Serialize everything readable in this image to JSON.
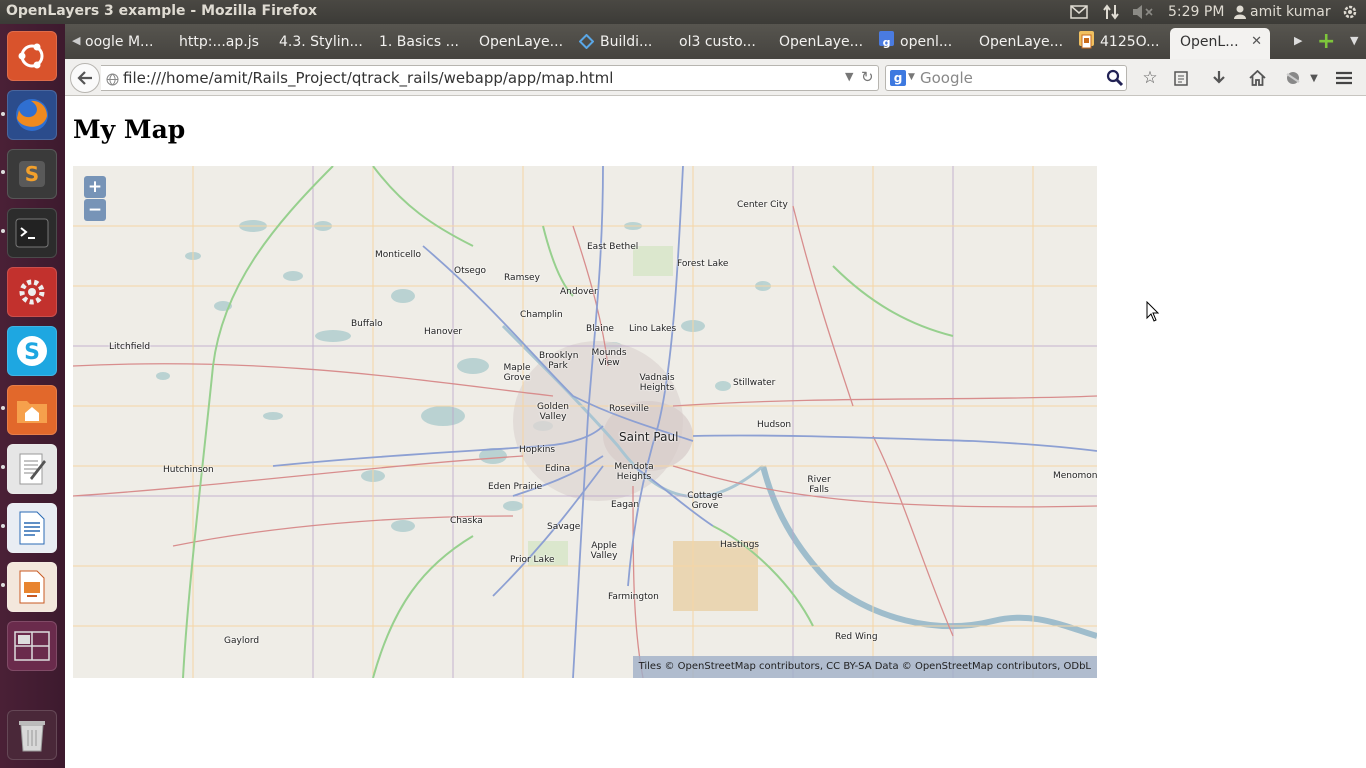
{
  "window": {
    "title": "OpenLayers 3 example - Mozilla Firefox"
  },
  "top_panel": {
    "time": "5:29 PM",
    "user": "amit kumar"
  },
  "launcher": {
    "items": [
      "ubuntu-dash-icon",
      "firefox-icon",
      "sublime-text-icon",
      "terminal-icon",
      "system-settings-icon",
      "skype-icon",
      "files-icon",
      "text-editor-icon",
      "libreoffice-writer-icon",
      "libreoffice-impress-icon",
      "workspace-switcher-icon",
      "trash-icon"
    ]
  },
  "tabs": [
    {
      "label": "oogle M...",
      "favicon": "none"
    },
    {
      "label": "http:...ap.js",
      "favicon": "none"
    },
    {
      "label": "4.3. Stylin...",
      "favicon": "none"
    },
    {
      "label": "1. Basics ...",
      "favicon": "none"
    },
    {
      "label": "OpenLaye...",
      "favicon": "none"
    },
    {
      "label": "Buildi...",
      "favicon": "diamond-icon"
    },
    {
      "label": "ol3 custo...",
      "favicon": "none"
    },
    {
      "label": "OpenLaye...",
      "favicon": "none"
    },
    {
      "label": "openl...",
      "favicon": "google-icon"
    },
    {
      "label": "OpenLaye...",
      "favicon": "none"
    },
    {
      "label": "4125O...",
      "favicon": "doc-icon"
    },
    {
      "label": "OpenL...",
      "favicon": "none",
      "active": true
    }
  ],
  "navbar": {
    "url": "file:///home/amit/Rails_Project/qtrack_rails/webapp/app/map.html",
    "search_placeholder": "Google"
  },
  "page": {
    "title": "My Map",
    "zoom_in": "+",
    "zoom_out": "−",
    "attribution": "Tiles © OpenStreetMap contributors, CC BY-SA    Data © OpenStreetMap contributors, ODbL"
  },
  "map_labels": {
    "center_city": "Center City",
    "east_bethel": "East Bethel",
    "forest_lake": "Forest Lake",
    "monticello": "Monticello",
    "otsego": "Otsego",
    "ramsey": "Ramsey",
    "andover": "Andover",
    "champlin": "Champlin",
    "buffalo": "Buffalo",
    "hanover": "Hanover",
    "blaine": "Blaine",
    "lino_lakes": "Lino Lakes",
    "litchfield": "Litchfield",
    "brooklyn_park": "Brooklyn Park",
    "mounds_view": "Mounds View",
    "maple_grove": "Maple Grove",
    "vadnais_heights": "Vadnais Heights",
    "stillwater": "Stillwater",
    "golden_valley": "Golden Valley",
    "roseville": "Roseville",
    "saint_paul": "Saint Paul",
    "hudson": "Hudson",
    "hopkins": "Hopkins",
    "hutchinson": "Hutchinson",
    "edina": "Edina",
    "mendota_heights": "Mendota Heights",
    "river_falls": "River Falls",
    "menomonie": "Menomonie",
    "eden_prairie": "Eden Prairie",
    "cottage_grove": "Cottage Grove",
    "eagan": "Eagan",
    "chaska": "Chaska",
    "savage": "Savage",
    "hastings": "Hastings",
    "apple_valley": "Apple Valley",
    "prior_lake": "Prior Lake",
    "farmington": "Farmington",
    "red_wing": "Red Wing",
    "gaylord": "Gaylord"
  }
}
